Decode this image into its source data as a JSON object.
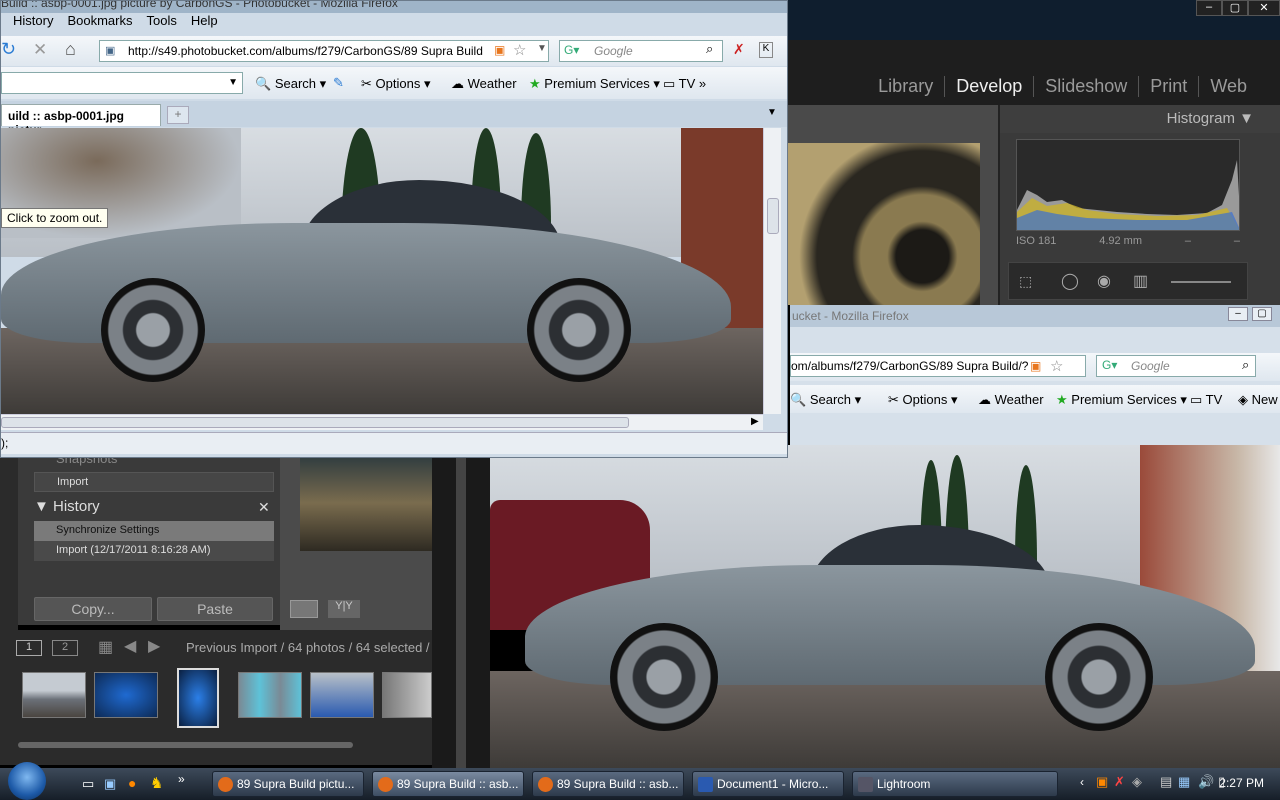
{
  "firefox_main": {
    "title": "Build :: asbp-0001.jpg picture by CarbonGS - Photobucket - Mozilla Firefox",
    "menu": [
      "History",
      "Bookmarks",
      "Tools",
      "Help"
    ],
    "url": "http://s49.photobucket.com/albums/f279/CarbonGS/89 Supra Build",
    "search_placeholder": "Google",
    "toolbar": {
      "search": "Search",
      "options": "Options",
      "weather": "Weather",
      "premium": "Premium Services",
      "tv": "TV"
    },
    "tab_label": "uild :: asbp-0001.jpg pictur...",
    "tooltip": "Click to zoom out.",
    "status": ");"
  },
  "lightroom": {
    "modules": [
      "Library",
      "Develop",
      "Slideshow",
      "Print",
      "Web"
    ],
    "active_module": "Develop",
    "histogram_title": "Histogram",
    "histogram_info": {
      "iso": "ISO 181",
      "focal": "4.92 mm",
      "a": "–",
      "b": "–"
    },
    "snapshots_label": "Snapshots",
    "snapshot_items": [
      "Import"
    ],
    "history_title": "History",
    "history_items": [
      "Synchronize Settings",
      "Import (12/17/2011 8:16:28 AM)"
    ],
    "copy_button": "Copy...",
    "paste_button": "Paste",
    "filmstrip": {
      "page1": "1",
      "page2": "2",
      "source": "Previous Import / 64 photos / 64 selected /"
    }
  },
  "firefox_second": {
    "title": "ucket - Mozilla Firefox",
    "url": "om/albums/f279/CarbonGS/89 Supra Build/?",
    "search_placeholder": "Google",
    "toolbar": {
      "search": "Search",
      "options": "Options",
      "weather": "Weather",
      "premium": "Premium Services",
      "tv": "TV",
      "new": "New"
    }
  },
  "taskbar": {
    "tasks": [
      "89 Supra Build pictu...",
      "89 Supra Build :: asb...",
      "89 Supra Build :: asb...",
      "Document1 - Micro...",
      "Lightroom"
    ],
    "clock": "2:27 PM"
  }
}
